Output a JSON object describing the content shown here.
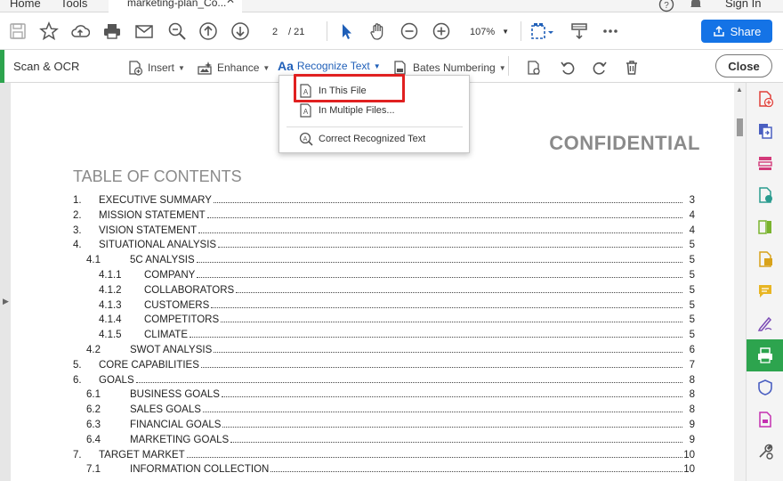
{
  "menubar": {
    "home": "Home",
    "tools": "Tools",
    "doc_tab": "marketing-plan_Co...",
    "sign_in": "Sign In"
  },
  "toolbar": {
    "page_current": "2",
    "page_total": "/ 21",
    "zoom": "107%",
    "share_label": "Share"
  },
  "ocr_toolbar": {
    "title": "Scan & OCR",
    "insert": "Insert",
    "enhance": "Enhance",
    "recognize_text": "Recognize Text",
    "bates_numbering": "Bates Numbering",
    "close": "Close"
  },
  "dropdown": {
    "items": [
      "In This File",
      "In Multiple Files...",
      "Correct Recognized Text"
    ]
  },
  "document": {
    "confidential": "CONFIDENTIAL",
    "toc_title": "TABLE OF CONTENTS",
    "toc": [
      {
        "num": "1.",
        "label": "EXECUTIVE SUMMARY",
        "page": "3"
      },
      {
        "num": "2.",
        "label": "MISSION STATEMENT",
        "page": "4"
      },
      {
        "num": "3.",
        "label": "VISION STATEMENT",
        "page": "4"
      },
      {
        "num": "4.",
        "label": "SITUATIONAL ANALYSIS",
        "page": "5"
      },
      {
        "num": "4.1",
        "label": "5C ANALYSIS",
        "page": "5"
      },
      {
        "num": "4.1.1",
        "label": "COMPANY",
        "page": "5"
      },
      {
        "num": "4.1.2",
        "label": "COLLABORATORS",
        "page": "5"
      },
      {
        "num": "4.1.3",
        "label": "CUSTOMERS",
        "page": "5"
      },
      {
        "num": "4.1.4",
        "label": "COMPETITORS",
        "page": "5"
      },
      {
        "num": "4.1.5",
        "label": "CLIMATE",
        "page": "5"
      },
      {
        "num": "4.2",
        "label": "SWOT ANALYSIS",
        "page": "6"
      },
      {
        "num": "5.",
        "label": "CORE CAPABILITIES",
        "page": "7"
      },
      {
        "num": "6.",
        "label": "GOALS",
        "page": "8"
      },
      {
        "num": "6.1",
        "label": "BUSINESS GOALS",
        "page": "8"
      },
      {
        "num": "6.2",
        "label": "SALES GOALS",
        "page": "8"
      },
      {
        "num": "6.3",
        "label": "FINANCIAL GOALS",
        "page": "9"
      },
      {
        "num": "6.4",
        "label": "MARKETING GOALS",
        "page": "9"
      },
      {
        "num": "7.",
        "label": "TARGET MARKET",
        "page": "10"
      },
      {
        "num": "7.1",
        "label": "INFORMATION COLLECTION",
        "page": "10"
      }
    ]
  },
  "colors": {
    "accent_blue": "#1473e6",
    "ocr_green": "#2da44e",
    "highlight_red": "#e02020"
  }
}
